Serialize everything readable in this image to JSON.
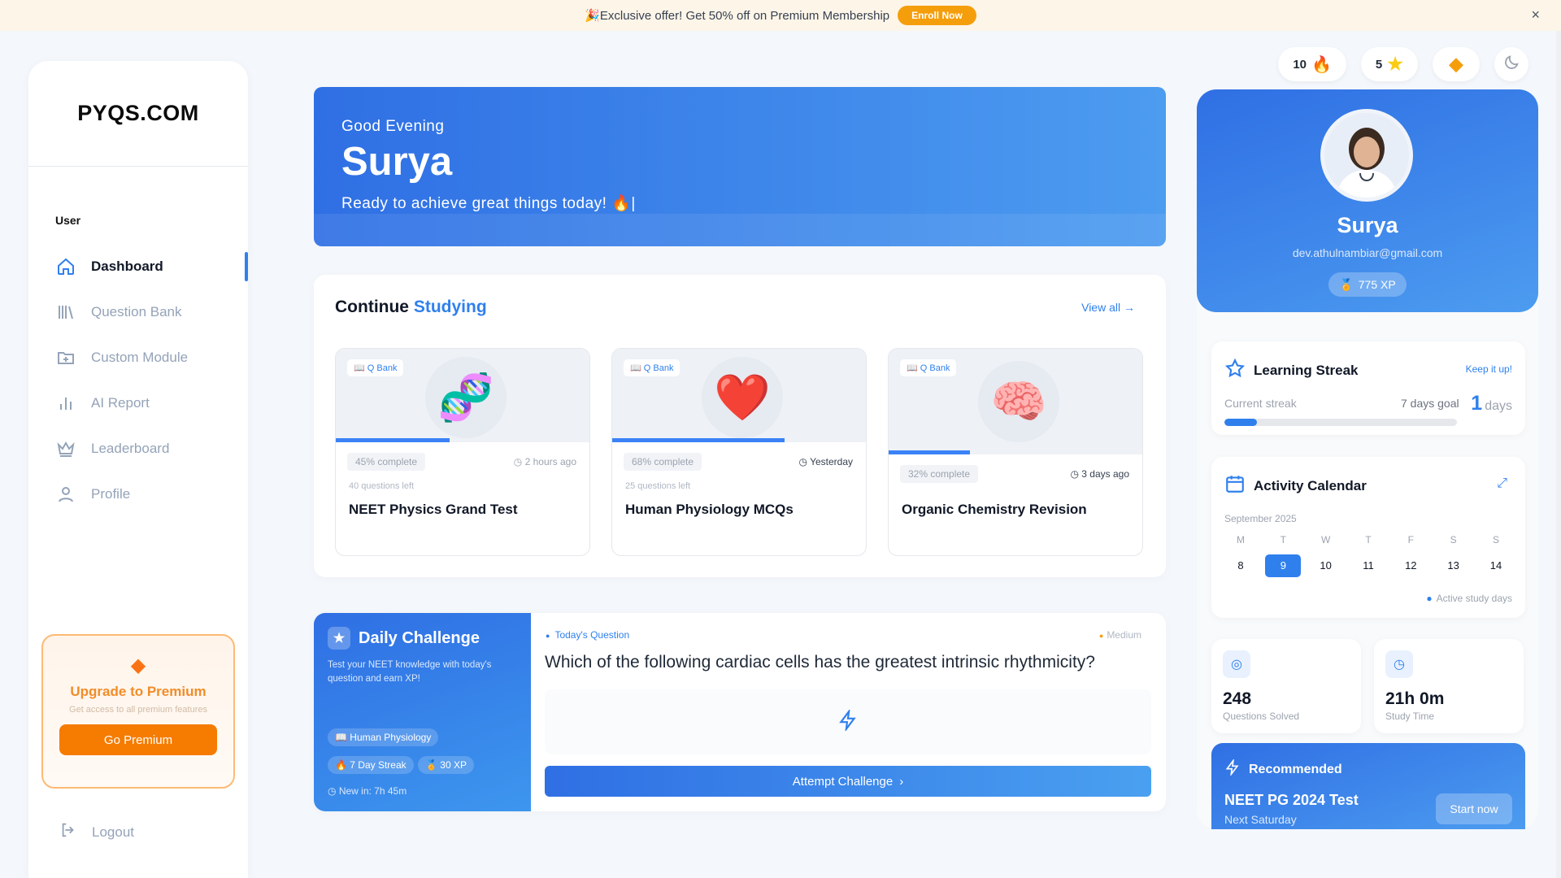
{
  "banner": {
    "text": "🎉Exclusive offer! Get 50% off on Premium Membership",
    "cta": "Enroll Now",
    "close_icon": "×"
  },
  "sidebar": {
    "logo": "PYQS.COM",
    "section": "User",
    "items": [
      {
        "label": "Dashboard",
        "icon": "home-icon",
        "active": true
      },
      {
        "label": "Question Bank",
        "icon": "library-icon"
      },
      {
        "label": "Custom Module",
        "icon": "folder-plus-icon"
      },
      {
        "label": "AI Report",
        "icon": "bar-chart-icon"
      },
      {
        "label": "Leaderboard",
        "icon": "crown-icon"
      },
      {
        "label": "Profile",
        "icon": "user-icon"
      }
    ],
    "premium": {
      "title": "Upgrade to Premium",
      "subtitle": "Get access to all premium features",
      "button": "Go Premium"
    },
    "logout": "Logout"
  },
  "topbar": {
    "streak_count": "10",
    "star_count": "5"
  },
  "hero": {
    "greeting": "Good Evening",
    "name": "Surya",
    "tagline": "Ready to achieve great things today! 🔥|"
  },
  "continue": {
    "title_a": "Continue",
    "title_b": "Studying",
    "view_all": "View all",
    "cards": [
      {
        "tag": "Q Bank",
        "progress": "45% complete",
        "progress_value": 0.45,
        "when": "2 hours ago",
        "left": "40 questions left",
        "title": "NEET Physics Grand Test",
        "emoji": "🧬"
      },
      {
        "tag": "Q Bank",
        "progress": "68% complete",
        "progress_value": 0.68,
        "when": "Yesterday",
        "left": "25 questions left",
        "title": "Human Physiology MCQs",
        "emoji": "❤️"
      },
      {
        "tag": "Q Bank",
        "progress": "32% complete",
        "progress_value": 0.32,
        "when": "3 days ago",
        "left": "",
        "title": "Organic Chemistry Revision",
        "emoji": "🧠"
      }
    ]
  },
  "daily": {
    "title": "Daily Challenge",
    "desc": "Test your NEET knowledge with today's question and earn XP!",
    "chips": [
      "Human Physiology",
      "7 Day Streak",
      "30 XP"
    ],
    "new_in": "New in: 7h 45m",
    "label": "Today's Question",
    "difficulty": "Medium",
    "question": "Which of the following cardiac cells has the greatest intrinsic rhythmicity?",
    "button": "Attempt Challenge"
  },
  "profile": {
    "name": "Surya",
    "email": "dev.athulnambiar@gmail.com",
    "xp": "775 XP"
  },
  "streak": {
    "title": "Learning Streak",
    "keep": "Keep it up!",
    "current_label": "Current streak",
    "goal": "7 days goal",
    "value": "1",
    "unit": "days",
    "progress": 0.14
  },
  "calendar": {
    "title": "Activity Calendar",
    "month": "September 2025",
    "day_names": [
      "M",
      "T",
      "W",
      "T",
      "F",
      "S",
      "S"
    ],
    "dates": [
      "8",
      "9",
      "10",
      "11",
      "12",
      "13",
      "14"
    ],
    "today_index": 1,
    "legend": "Active study days"
  },
  "stats": [
    {
      "value": "248",
      "label": "Questions Solved",
      "icon": "target-icon"
    },
    {
      "value": "21h 0m",
      "label": "Study Time",
      "icon": "clock-icon"
    }
  ],
  "recommended": {
    "title": "Recommended",
    "test": "NEET PG 2024 Test",
    "when": "Next Saturday",
    "button": "Start now"
  },
  "colors": {
    "primary": "#2f80ed",
    "accent": "#f57c00"
  }
}
